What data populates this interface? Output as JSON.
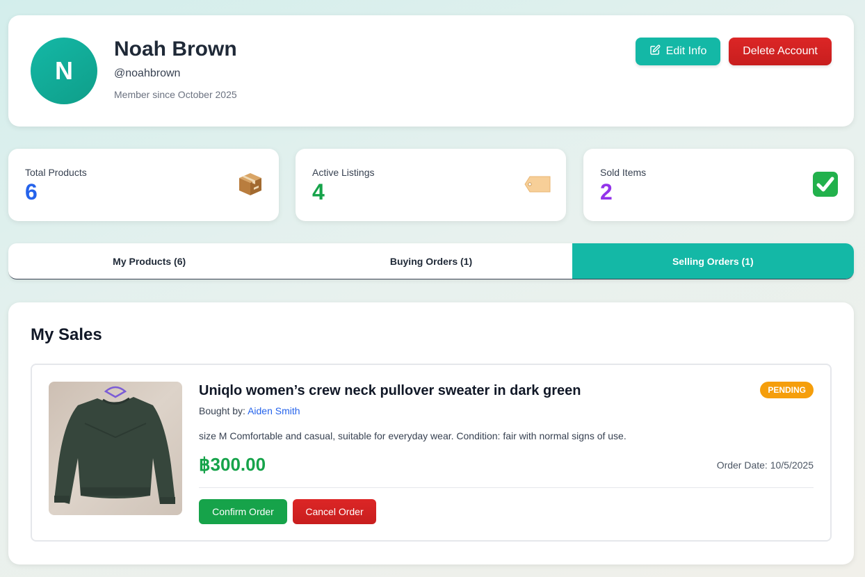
{
  "profile": {
    "initial": "N",
    "name": "Noah Brown",
    "handle": "@noahbrown",
    "member_since": "Member since October 2025",
    "edit_label": "Edit Info",
    "delete_label": "Delete Account"
  },
  "stats": [
    {
      "label": "Total Products",
      "value": "6",
      "color": "#2563eb",
      "icon": "package-icon"
    },
    {
      "label": "Active Listings",
      "value": "4",
      "color": "#16a34a",
      "icon": "tag-icon"
    },
    {
      "label": "Sold Items",
      "value": "2",
      "color": "#9333ea",
      "icon": "check-mark-icon"
    }
  ],
  "tabs": [
    {
      "label": "My Products (6)",
      "active": false
    },
    {
      "label": "Buying Orders (1)",
      "active": false
    },
    {
      "label": "Selling Orders (1)",
      "active": true
    }
  ],
  "sales": {
    "title": "My Sales",
    "order": {
      "title": "Uniqlo women’s crew neck pullover sweater in dark green",
      "bought_by_label": "Bought by:",
      "buyer": "Aiden Smith",
      "description": "size M Comfortable and casual, suitable for everyday wear. Condition: fair with normal signs of use.",
      "price": "฿300.00",
      "order_date": "Order Date: 10/5/2025",
      "status": "PENDING",
      "confirm_label": "Confirm Order",
      "cancel_label": "Cancel Order"
    }
  },
  "colors": {
    "accent": "#14b8a6",
    "danger": "#dc2626",
    "success": "#16a34a",
    "warning": "#f59e0b",
    "link": "#2563eb"
  }
}
